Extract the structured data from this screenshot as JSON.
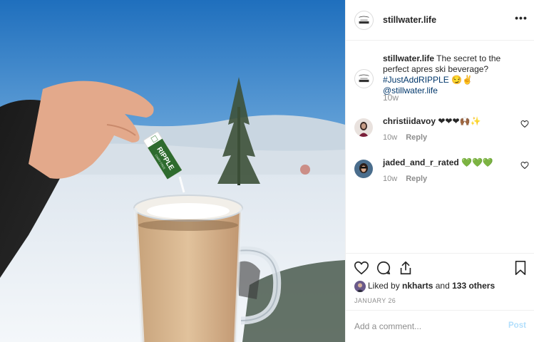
{
  "post": {
    "author": "stillwater.life",
    "more_label": "•••",
    "photo_label": "RIPPLE",
    "photo_sublabel": "DAIRY FREE"
  },
  "caption": {
    "username": "stillwater.life",
    "text": " The secret to the perfect apres ski beverage? ",
    "hashtag": "#JustAddRIPPLE",
    "emoji": " 😏✌ ",
    "mention": "@stillwater.life",
    "time": "10w"
  },
  "comments": [
    {
      "username": "christiidavoy",
      "text": " ❤❤❤🙌🏾✨",
      "time": "10w",
      "reply": "Reply"
    },
    {
      "username": "jaded_and_r_rated",
      "text": " 💚💚💚",
      "time": "10w",
      "reply": "Reply"
    }
  ],
  "likes": {
    "prefix": "Liked by ",
    "user": "nkharts",
    "middle": " and ",
    "others": "133 others"
  },
  "date": "JANUARY 26",
  "add_comment": {
    "placeholder": "Add a comment...",
    "post_label": "Post"
  },
  "colors": {
    "link": "#00376b",
    "muted": "#8e8e8e",
    "post_disabled": "#b2dffc",
    "ripple_green": "#2e6b2e"
  }
}
